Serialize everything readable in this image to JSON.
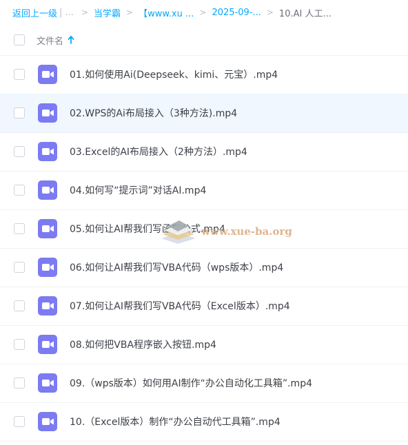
{
  "breadcrumb": {
    "back": "返回上一级",
    "back_sep": "| ...",
    "items": [
      "当学霸",
      "【www.xu ...",
      "2025-09-..."
    ],
    "current": "10.AI 人工..."
  },
  "header": {
    "column_label": "文件名"
  },
  "files": [
    "01.如何使用Ai(Deepseek、kimi、元宝）.mp4",
    "02.WPS的Ai布局接入（3种方法).mp4",
    "03.Excel的AI布局接入（2种方法）.mp4",
    "04.如何写“提示词”对话AI.mp4",
    "05.如何让AI帮我们写函数公式.mp4",
    "06.如何让AI帮我们写VBA代码（wps版本）.mp4",
    "07.如何让AI帮我们写VBA代码（Excel版本）.mp4",
    "08.如何把VBA程序嵌入按钮.mp4",
    "09.（wps版本）如何用AI制作“办公自动化工具箱”.mp4",
    "10.（Excel版本）制作“办公自动代工具箱”.mp4"
  ],
  "watermark": "www.xue-ba.org",
  "colors": {
    "accent": "#06a7ff",
    "video_icon": "#7c7bf2",
    "hover_row": "#f0f7fe"
  },
  "icons": {
    "sort": "arrow-up-icon",
    "file": "video-file-icon",
    "watermark": "book-stack-logo"
  }
}
